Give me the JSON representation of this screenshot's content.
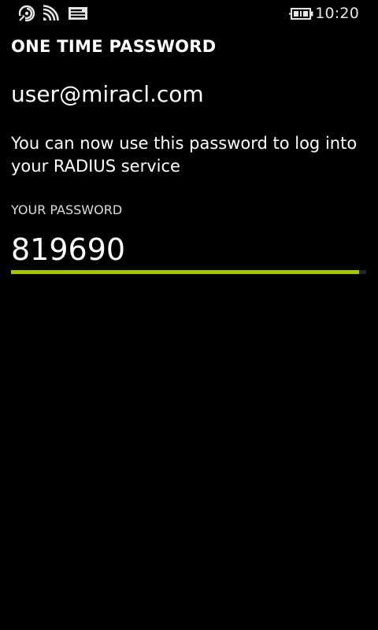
{
  "status_bar": {
    "icons": [
      "data-sense-icon",
      "wifi-icon",
      "notification-icon",
      "battery-charging-icon"
    ],
    "time": "10:20"
  },
  "screen": {
    "title": "ONE TIME PASSWORD",
    "account": "user@miracl.com",
    "message": "You can now use this password to log into your RADIUS service",
    "password_label": "YOUR PASSWORD",
    "password": "819690",
    "validity_remaining_fraction": 0.98
  },
  "colors": {
    "background": "#000000",
    "text": "#ffffff",
    "accent": "#a4c400",
    "track": "#262626"
  }
}
